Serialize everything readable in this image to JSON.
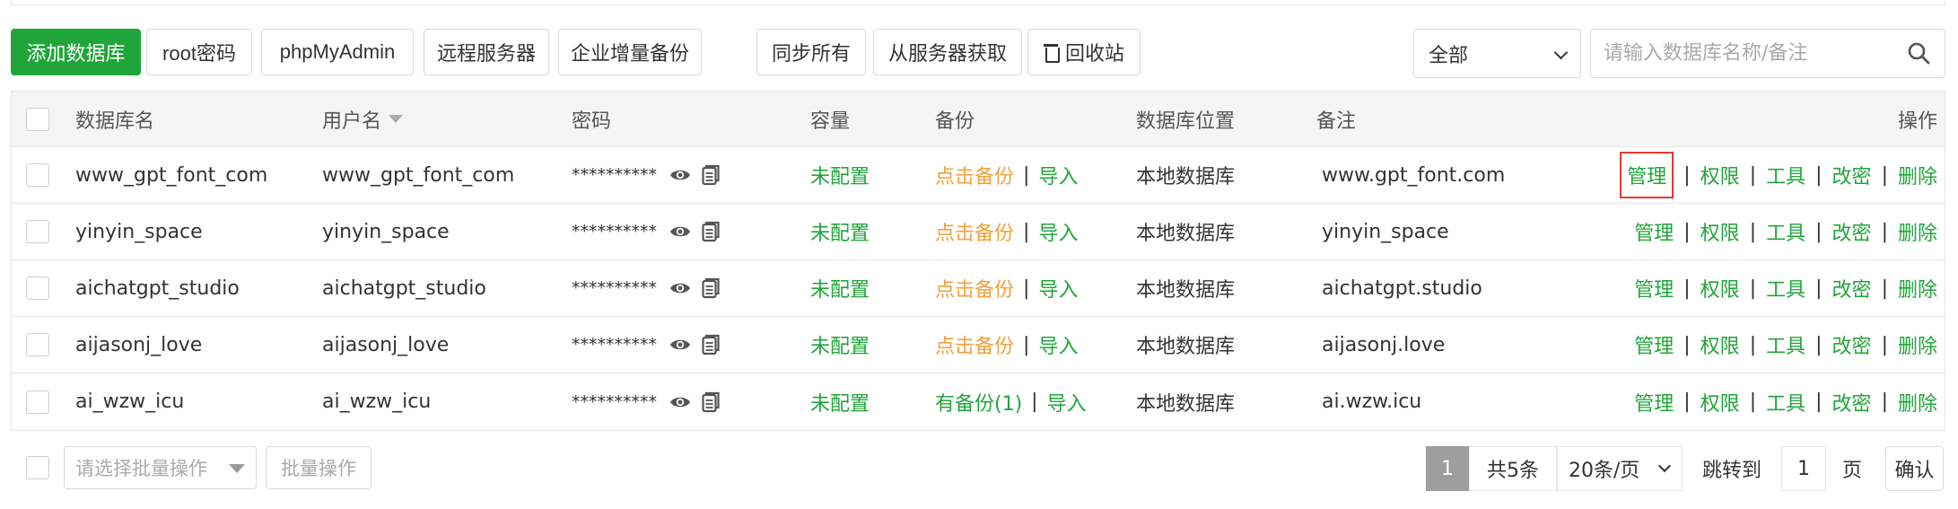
{
  "toolbar": {
    "add_database": "添加数据库",
    "root_password": "root密码",
    "phpmyadmin": "phpMyAdmin",
    "remote_server": "远程服务器",
    "enterprise_backup": "企业增量备份",
    "sync_all": "同步所有",
    "fetch_from_server": "从服务器获取",
    "recycle_bin": "回收站"
  },
  "filter": {
    "selected": "全部",
    "search_placeholder": "请输入数据库名称/备注"
  },
  "table": {
    "headers": {
      "name": "数据库名",
      "user": "用户名",
      "password": "密码",
      "capacity": "容量",
      "backup": "备份",
      "location": "数据库位置",
      "note": "备注",
      "actions": "操作"
    },
    "rows": [
      {
        "name": "www_gpt_font_com",
        "user": "www_gpt_font_com",
        "password": "**********",
        "capacity": "未配置",
        "backup": "点击备份",
        "import": "导入",
        "location": "本地数据库",
        "note": "www.gpt_font.com"
      },
      {
        "name": "yinyin_space",
        "user": "yinyin_space",
        "password": "**********",
        "capacity": "未配置",
        "backup": "点击备份",
        "import": "导入",
        "location": "本地数据库",
        "note": "yinyin_space"
      },
      {
        "name": "aichatgpt_studio",
        "user": "aichatgpt_studio",
        "password": "**********",
        "capacity": "未配置",
        "backup": "点击备份",
        "import": "导入",
        "location": "本地数据库",
        "note": "aichatgpt.studio"
      },
      {
        "name": "aijasonj_love",
        "user": "aijasonj_love",
        "password": "**********",
        "capacity": "未配置",
        "backup": "点击备份",
        "import": "导入",
        "location": "本地数据库",
        "note": "aijasonj.love"
      },
      {
        "name": "ai_wzw_icu",
        "user": "ai_wzw_icu",
        "password": "**********",
        "capacity": "未配置",
        "backup": "有备份(1)",
        "import": "导入",
        "location": "本地数据库",
        "note": "ai.wzw.icu"
      }
    ],
    "actions": {
      "manage": "管理",
      "permission": "权限",
      "tools": "工具",
      "change_password": "改密",
      "delete": "删除"
    },
    "separator": "|"
  },
  "footer": {
    "batch_placeholder": "请选择批量操作",
    "batch_button": "批量操作",
    "current_page": "1",
    "total": "共5条",
    "page_size": "20条/页",
    "jump_to": "跳转到",
    "jump_value": "1",
    "page_unit": "页",
    "confirm": "确认"
  },
  "colors": {
    "accent": "#20a53a",
    "backup_link": "#f0a23b",
    "highlight": "#e53935"
  },
  "icons": {
    "view_password": "eye-icon",
    "copy_password": "copy-icon",
    "search": "search-icon",
    "recycle": "trash-icon"
  }
}
